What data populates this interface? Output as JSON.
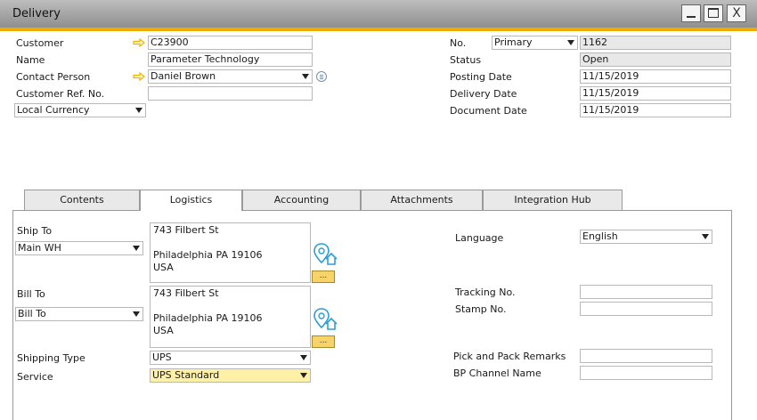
{
  "window": {
    "title": "Delivery",
    "min_glyph": "",
    "max_glyph": "",
    "close_glyph": "X"
  },
  "header": {
    "customer_label": "Customer",
    "customer_value": "C23900",
    "name_label": "Name",
    "name_value": "Parameter Technology",
    "contact_label": "Contact Person",
    "contact_value": "Daniel Brown",
    "custref_label": "Customer Ref. No.",
    "custref_value": "",
    "currency_value": "Local Currency",
    "no_label": "No.",
    "series_value": "Primary",
    "no_value": "1162",
    "status_label": "Status",
    "status_value": "Open",
    "posting_label": "Posting Date",
    "posting_value": "11/15/2019",
    "delivery_label": "Delivery Date",
    "delivery_value": "11/15/2019",
    "document_label": "Document Date",
    "document_value": "11/15/2019"
  },
  "tabs": [
    {
      "label": "Contents"
    },
    {
      "label": "Logistics",
      "active": true
    },
    {
      "label": "Accounting"
    },
    {
      "label": "Attachments"
    },
    {
      "label": "Integration Hub"
    }
  ],
  "logistics": {
    "shipto_label": "Ship To",
    "shipto_select": "Main WH",
    "shipto_address": [
      "743 Filbert St",
      "",
      "Philadelphia PA  19106",
      "USA"
    ],
    "billto_label": "Bill To",
    "billto_select": "Bill To",
    "billto_address": [
      "743 Filbert St",
      "",
      "Philadelphia PA  19106",
      "USA"
    ],
    "dots_label": "...",
    "shipping_type_label": "Shipping Type",
    "shipping_type_value": "UPS",
    "service_label": "Service",
    "service_value": "UPS Standard",
    "language_label": "Language",
    "language_value": "English",
    "tracking_label": "Tracking No.",
    "tracking_value": "",
    "stamp_label": "Stamp No.",
    "stamp_value": "",
    "pickpack_label": "Pick and Pack Remarks",
    "pickpack_value": "",
    "bpchannel_label": "BP Channel Name",
    "bpchannel_value": ""
  },
  "colors": {
    "accent": "#f0ab00",
    "link_arrow": "#f0b400",
    "location_icon": "#2a9fd6",
    "highlight_field": "#fff0a8"
  }
}
